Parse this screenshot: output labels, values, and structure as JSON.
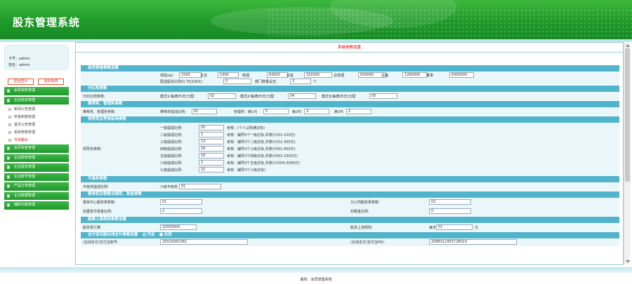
{
  "header": {
    "title": "股东管理系统"
  },
  "sidebar": {
    "card_no": "卡号：admin",
    "name": "姓名：admin",
    "back_home": "返回首页",
    "logout": "退出系统",
    "groups": [
      {
        "label": "会员资料管理"
      },
      {
        "label": "企业信息管理",
        "subs": [
          "新闻公告管理",
          "奖金制度管理",
          "首页公告管理",
          "系统参数管理",
          "今日股价"
        ]
      },
      {
        "label": "会员资金管理"
      },
      {
        "label": "企业财务管理"
      },
      {
        "label": "企业留言管理"
      },
      {
        "label": "企业账号管理"
      },
      {
        "label": "产品订单管理"
      },
      {
        "label": "企业数据管理"
      },
      {
        "label": "辅助功能管理"
      }
    ]
  },
  "main": {
    "title": "系统参数设置",
    "s1": {
      "title": "会员资格参数设置",
      "levels": [
        {
          "lbl": "体验vip:",
          "val": "1500"
        },
        {
          "lbl": "主任",
          "val": "1000"
        },
        {
          "lbl": "经理",
          "val": "63000"
        },
        {
          "lbl": "总监",
          "val": "315000"
        },
        {
          "lbl": "总经理",
          "val": "630000"
        },
        {
          "lbl": "总裁",
          "val": "1260000"
        },
        {
          "lbl": "董事",
          "val": "6300000"
        }
      ],
      "ratio_lbl": "配送股份比例(0.70|100X):",
      "ratio_val": "0",
      "dept_lbl": "部门数量设定:",
      "dept_val": "3",
      "dept_unit": "个"
    },
    "s2": {
      "title": "分红奖参数",
      "lbl": "分红比例参数:",
      "items": [
        {
          "lbl": "模式1(每满35天)分配",
          "val": "02"
        },
        {
          "lbl": "模式2(每满35天)分配",
          "val": "04"
        },
        {
          "lbl": "模式3(每满35天)分配",
          "val": "05"
        }
      ]
    },
    "s3": {
      "title": "推荐奖、管理奖参数",
      "lbl": "推荐奖、管理奖参数:",
      "rec_lbl": "推荐奖提成比例:",
      "rec_val": "01",
      "mgr_lbl": "管理奖：第1代",
      "v1": "5",
      "g2": "第2代",
      "v2": "3",
      "g3": "第3代",
      "v3": "2"
    },
    "s4": {
      "title": "领导奖及考核标准参数",
      "lbl": "领导奖参数:",
      "rows": [
        {
          "lvl": "一级提成比例:",
          "val": "05",
          "note": "考核：(个人认购满达标)"
        },
        {
          "lvl": "二级提成比例:",
          "val": "1",
          "note": "考核：辅导5个一级达标,并累计151-150万)"
        },
        {
          "lvl": "三级提成比例:",
          "val": "13",
          "note": "考核：辅导3个二级达标,并累计151-300万)"
        },
        {
          "lvl": "四级提成比例:",
          "val": "16",
          "note": "考核：辅导3个三级达标,并累计451-900万)"
        },
        {
          "lvl": "五级提成比例:",
          "val": "18",
          "note": "考核：辅导3个四级达标,并累计901-1500万)"
        },
        {
          "lvl": "六级提成比例:",
          "val": "2",
          "note": "考核：辅导3个五级达标,并累计1500-3000万)"
        },
        {
          "lvl": "七级提成比例:",
          "val": "22",
          "note": "考核：辅导3个六级达标)"
        }
      ]
    },
    "s5": {
      "title": "平级奖参数",
      "lbl": "平级奖提成比例:",
      "sub_lbl": "六级平级奖",
      "val": "01"
    },
    "s6": {
      "title": "报单奖及销售业绩奖、税金参数",
      "l1": "报单中心服务费参数:",
      "v1": "01",
      "l2": "分公司服务费参数:",
      "v2": "02",
      "l3": "扣重复交易金比例:",
      "v3": "2",
      "l4": "扣税金比例:",
      "v4": "0"
    },
    "s7": {
      "title": "股票上涨规则参数设置",
      "l1": "股票发行量:",
      "v1": "10000000",
      "l2": "股票上涨规则:",
      "v2_pre": "每天",
      "v2": "01",
      "v2_unit": "元"
    },
    "s8": {
      "title": "支付宝功能在线支付参数设置",
      "on": "开启",
      "off": "关闭",
      "l1": "(在线支付)支付宝账号:",
      "v1": "18318361582",
      "l2": "(在线支付)支付宝PID:",
      "v2": "2088312455728010"
    }
  },
  "footer": {
    "text": "版权：会员管理系统"
  }
}
